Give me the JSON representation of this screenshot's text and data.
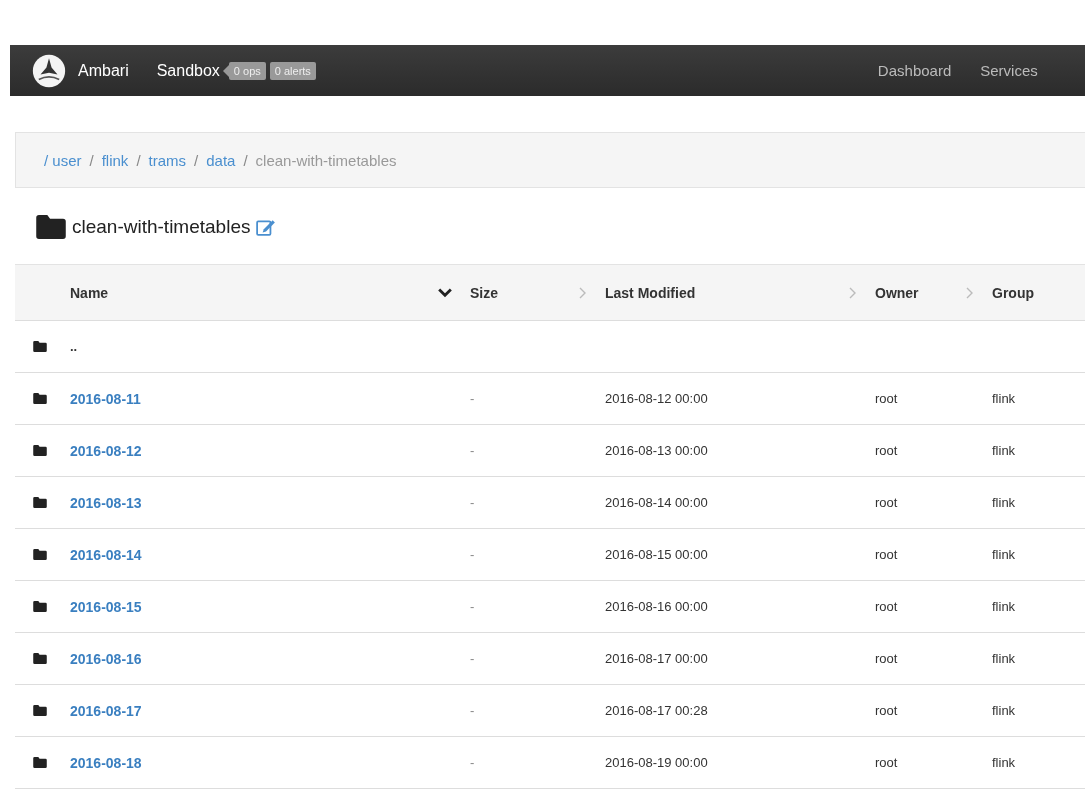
{
  "navbar": {
    "brand": "Ambari",
    "cluster": "Sandbox",
    "badges": [
      "0 ops",
      "0 alerts"
    ],
    "links": [
      {
        "label": "Dashboard",
        "selected": false
      },
      {
        "label": "Services",
        "selected": false
      }
    ]
  },
  "breadcrumb_separator": "/",
  "breadcrumb": [
    {
      "label": "/ user",
      "kind": "link"
    },
    {
      "label": "flink",
      "kind": "link"
    },
    {
      "label": "trams",
      "kind": "link"
    },
    {
      "label": "data",
      "kind": "link"
    },
    {
      "label": "clean-with-timetables",
      "kind": "current"
    }
  ],
  "folder_title": "clean-with-timetables",
  "table": {
    "columns": [
      {
        "label": "Name",
        "sorted": true
      },
      {
        "label": "Size",
        "sorted": false
      },
      {
        "label": "Last Modified",
        "sorted": false
      },
      {
        "label": "Owner",
        "sorted": false
      },
      {
        "label": "Group"
      }
    ],
    "parent_row": "..",
    "rows": [
      {
        "name": "2016-08-11",
        "size": "-",
        "modified": "2016-08-12 00:00",
        "owner": "root",
        "group": "flink"
      },
      {
        "name": "2016-08-12",
        "size": "-",
        "modified": "2016-08-13 00:00",
        "owner": "root",
        "group": "flink"
      },
      {
        "name": "2016-08-13",
        "size": "-",
        "modified": "2016-08-14 00:00",
        "owner": "root",
        "group": "flink"
      },
      {
        "name": "2016-08-14",
        "size": "-",
        "modified": "2016-08-15 00:00",
        "owner": "root",
        "group": "flink"
      },
      {
        "name": "2016-08-15",
        "size": "-",
        "modified": "2016-08-16 00:00",
        "owner": "root",
        "group": "flink"
      },
      {
        "name": "2016-08-16",
        "size": "-",
        "modified": "2016-08-17 00:00",
        "owner": "root",
        "group": "flink"
      },
      {
        "name": "2016-08-17",
        "size": "-",
        "modified": "2016-08-17 00:28",
        "owner": "root",
        "group": "flink"
      },
      {
        "name": "2016-08-18",
        "size": "-",
        "modified": "2016-08-19 00:00",
        "owner": "root",
        "group": "flink"
      }
    ]
  }
}
